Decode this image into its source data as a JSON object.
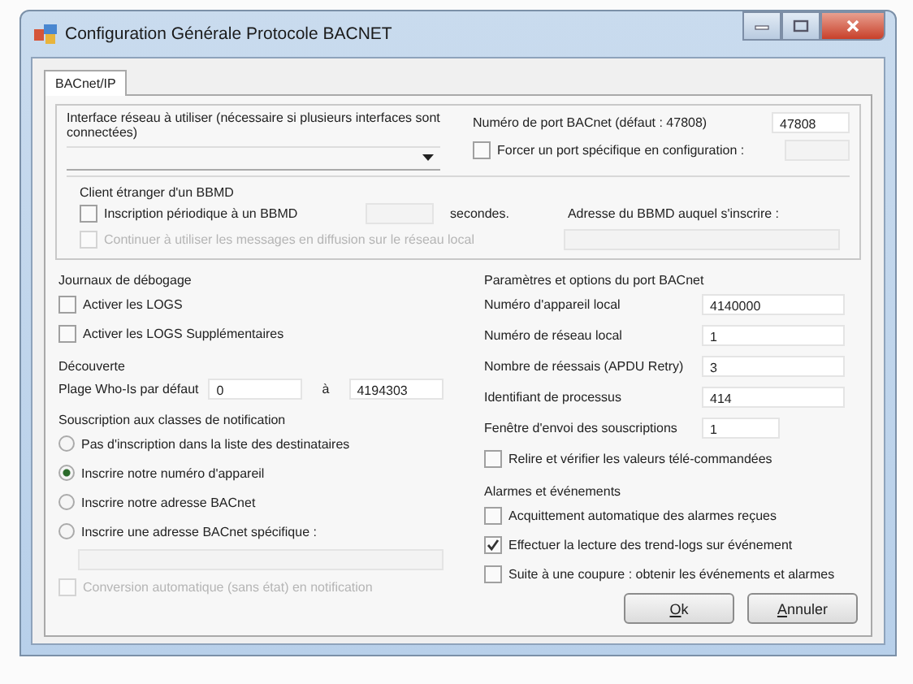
{
  "window": {
    "title": "Configuration Générale Protocole BACNET"
  },
  "tabs": [
    {
      "label": "BACnet/IP",
      "selected": true
    }
  ],
  "network": {
    "label": "Interface réseau à utiliser (nécessaire si plusieurs interfaces sont connectées)"
  },
  "port": {
    "label": "Numéro de port BACnet (défaut : 47808)",
    "value": "47808"
  },
  "force_port": {
    "label": "Forcer un port spécifique en configuration :",
    "checked": false
  },
  "bbmd": {
    "title": "Client étranger d'un BBMD",
    "register": {
      "label": "Inscription périodique à un BBMD",
      "checked": false,
      "unit": "secondes."
    },
    "address_label": "Adresse du BBMD auquel s'inscrire :",
    "broadcast": {
      "label": "Continuer à utiliser les messages en diffusion sur le réseau local",
      "checked": false,
      "disabled": true
    }
  },
  "debug": {
    "title": "Journaux de débogage",
    "items": [
      {
        "label": "Activer les LOGS",
        "checked": false
      },
      {
        "label": "Activer les LOGS Supplémentaires",
        "checked": false
      }
    ]
  },
  "discovery": {
    "title": "Découverte",
    "label": "Plage Who-Is par défaut",
    "from": "0",
    "to_label": "à",
    "to": "4194303"
  },
  "notification": {
    "title": "Souscription aux classes de notification",
    "options": [
      {
        "label": "Pas d'inscription dans la liste des destinataires",
        "selected": false
      },
      {
        "label": "Inscrire notre numéro d'appareil",
        "selected": true
      },
      {
        "label": "Inscrire notre adresse BACnet",
        "selected": false
      },
      {
        "label": "Inscrire une adresse BACnet spécifique :",
        "selected": false
      }
    ],
    "conversion": {
      "label": "Conversion automatique (sans état) en notification",
      "checked": false,
      "disabled": true
    }
  },
  "port_params": {
    "title": "Paramètres et options du port BACnet",
    "fields": [
      {
        "label": "Numéro d'appareil local",
        "value": "4140000"
      },
      {
        "label": "Numéro de réseau local",
        "value": "1"
      },
      {
        "label": "Nombre de réessais (APDU Retry)",
        "value": "3"
      },
      {
        "label": "Identifiant de processus",
        "value": "414"
      },
      {
        "label": "Fenêtre d'envoi des souscriptions",
        "value": "1"
      }
    ]
  },
  "reread": {
    "label": "Relire et vérifier les valeurs télé-commandées",
    "checked": false
  },
  "alarms": {
    "title": "Alarmes et événements",
    "items": [
      {
        "label": "Acquittement automatique des alarmes reçues",
        "checked": false
      },
      {
        "label": "Effectuer la lecture des trend-logs sur événement",
        "checked": true
      },
      {
        "label": "Suite à une coupure : obtenir les événements et alarmes",
        "checked": false
      }
    ]
  },
  "buttons": [
    {
      "label": "Ok"
    },
    {
      "label": "Annuler"
    }
  ]
}
